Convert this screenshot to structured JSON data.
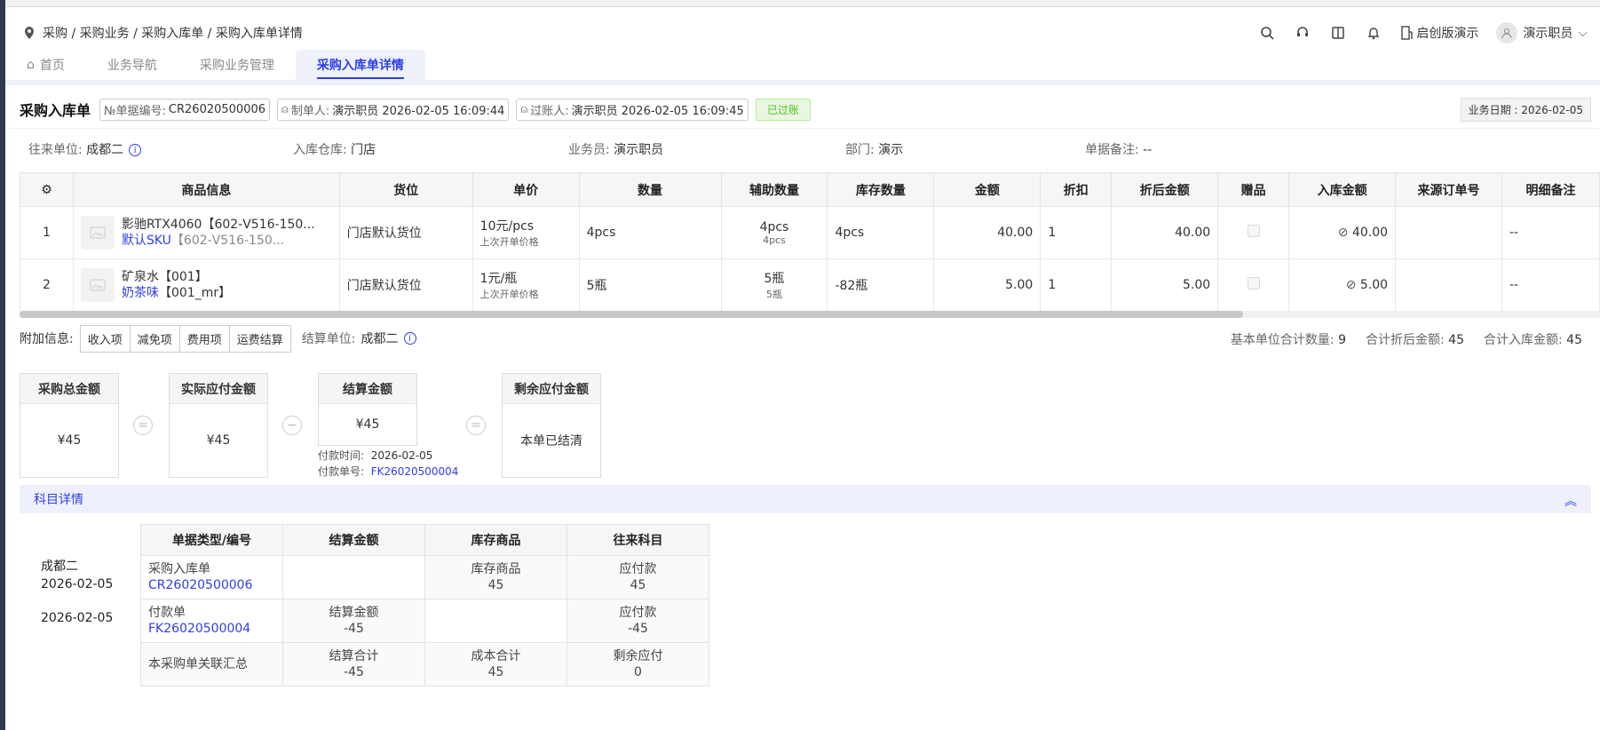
{
  "breadcrumb": "采购 / 采购业务 / 采购入库单 / 采购入库单详情",
  "header": {
    "company": "启创版演示",
    "user": "演示职员"
  },
  "tabs": [
    {
      "label": "首页"
    },
    {
      "label": "业务导航"
    },
    {
      "label": "采购业务管理"
    },
    {
      "label": "采购入库单详情"
    }
  ],
  "doc": {
    "title": "采购入库单",
    "no_label": "№单据编号:",
    "no_value": "CR26020500006",
    "maker_label": "制单人:",
    "maker_value": "演示职员  2026-02-05 16:09:44",
    "poster_label": "过账人:",
    "poster_value": "演示职员  2026-02-05 16:09:45",
    "status": "已过账",
    "biz_date": "业务日期 : 2026-02-05"
  },
  "info": {
    "partner_label": "往来单位:",
    "partner_value": "成都二",
    "warehouse_label": "入库仓库:",
    "warehouse_value": "门店",
    "staff_label": "业务员:",
    "staff_value": "演示职员",
    "dept_label": "部门:",
    "dept_value": "演示",
    "remark_label": "单据备注:",
    "remark_value": "--"
  },
  "table": {
    "headers": [
      "商品信息",
      "货位",
      "单价",
      "数量",
      "辅助数量",
      "库存数量",
      "金额",
      "折扣",
      "折后金额",
      "赠品",
      "入库金额",
      "来源订单号",
      "明细备注"
    ],
    "rows": [
      {
        "idx": "1",
        "name": "影驰RTX4060【602-V516-150...",
        "sku": "默认SKU",
        "sku_code": "【602-V516-150...",
        "loc": "门店默认货位",
        "price": "10元/pcs",
        "price_note": "上次开单价格",
        "qty": "4pcs",
        "aux": "4pcs",
        "aux_sub": "4pcs",
        "stock": "4pcs",
        "amount": "40.00",
        "discount": "1",
        "disc_amount": "40.00",
        "in_amount": "40.00",
        "remark": "--"
      },
      {
        "idx": "2",
        "name": "矿泉水【001】",
        "sku": "奶茶味",
        "sku_code": "【001_mr】",
        "loc": "门店默认货位",
        "price": "1元/瓶",
        "price_note": "上次开单价格",
        "qty": "5瓶",
        "aux": "5瓶",
        "aux_sub": "5瓶",
        "stock": "-82瓶",
        "amount": "5.00",
        "discount": "1",
        "disc_amount": "5.00",
        "in_amount": "5.00",
        "remark": "--"
      }
    ]
  },
  "extra": {
    "label": "附加信息:",
    "buttons": [
      "收入项",
      "减免项",
      "费用项",
      "运费结算"
    ],
    "settle_label": "结算单位:",
    "settle_value": "成都二",
    "totals": [
      {
        "label": "基本单位合计数量:",
        "value": "9"
      },
      {
        "label": "合计折后金额:",
        "value": "45"
      },
      {
        "label": "合计入库金额:",
        "value": "45"
      }
    ]
  },
  "cards": {
    "total": {
      "title": "采购总金额",
      "value": "¥45"
    },
    "payable": {
      "title": "实际应付金额",
      "value": "¥45"
    },
    "settle": {
      "title": "结算金额",
      "value": "¥45"
    },
    "remain": {
      "title": "剩余应付金额",
      "value": "本单已结清"
    },
    "pay_time_label": "付款时间:",
    "pay_time_value": "2026-02-05",
    "pay_no_label": "付款单号:",
    "pay_no_value": "FK26020500004"
  },
  "subject": {
    "title": "科目详情",
    "left_name": "成都二",
    "left_date1": "2026-02-05",
    "left_date2": "2026-02-05",
    "headers": [
      "单据类型/编号",
      "结算金额",
      "库存商品",
      "往来科目"
    ],
    "rows": [
      {
        "type": "采购入库单",
        "no": "CR26020500006",
        "settle": "",
        "settle_v": "",
        "stock": "库存商品",
        "stock_v": "45",
        "acct": "应付款",
        "acct_v": "45"
      },
      {
        "type": "付款单",
        "no": "FK26020500004",
        "settle": "结算金额",
        "settle_v": "-45",
        "stock": "",
        "stock_v": "",
        "acct": "应付款",
        "acct_v": "-45"
      },
      {
        "type": "本采购单关联汇总",
        "no": "",
        "settle": "结算合计",
        "settle_v": "-45",
        "stock": "成本合计",
        "stock_v": "45",
        "acct": "剩余应付",
        "acct_v": "0"
      }
    ]
  }
}
